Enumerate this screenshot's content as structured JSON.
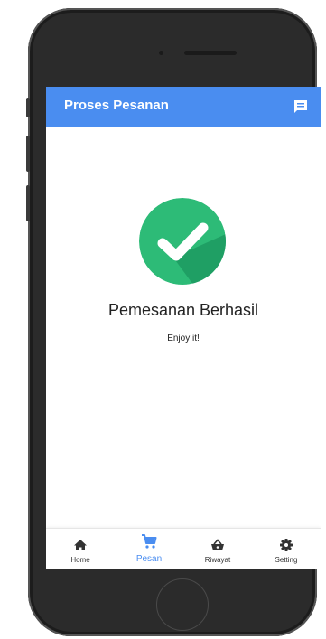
{
  "app_bar": {
    "title": "Proses Pesanan",
    "action_icon": "chat-icon"
  },
  "content": {
    "status_icon": "check-circle-icon",
    "title": "Pemesanan Berhasil",
    "subtitle": "Enjoy it!"
  },
  "bottom_nav": {
    "items": [
      {
        "label": "Home",
        "icon": "home-icon",
        "active": false
      },
      {
        "label": "Pesan",
        "icon": "cart-icon",
        "active": true
      },
      {
        "label": "Riwayat",
        "icon": "basket-icon",
        "active": false
      },
      {
        "label": "Setting",
        "icon": "gear-icon",
        "active": false
      }
    ]
  },
  "colors": {
    "primary": "#4a8df0",
    "success": "#2dbb77",
    "success_shadow": "#1f9f64",
    "device": "#2b2b2b"
  }
}
